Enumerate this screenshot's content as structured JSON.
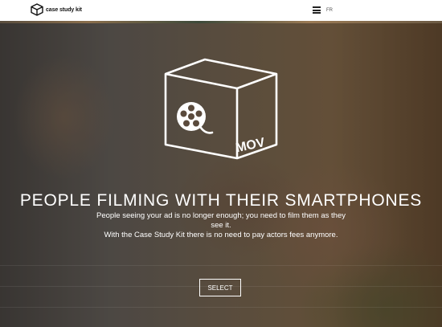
{
  "header": {
    "logo_text": "case study kit",
    "language_link": "FR"
  },
  "hero": {
    "icon_label": "MOV",
    "headline": "PEOPLE FILMING WITH THEIR SMARTPHONES",
    "description_line1": "People seeing your ad is no longer enough; you need to film them as they see it.",
    "description_line2": "With the Case Study Kit there is no need to pay actors fees anymore.",
    "select_label": "SELECT"
  },
  "icons": {
    "logo": "box-logo-icon",
    "menu": "hamburger-menu-icon",
    "product": "film-reel-box-icon"
  }
}
